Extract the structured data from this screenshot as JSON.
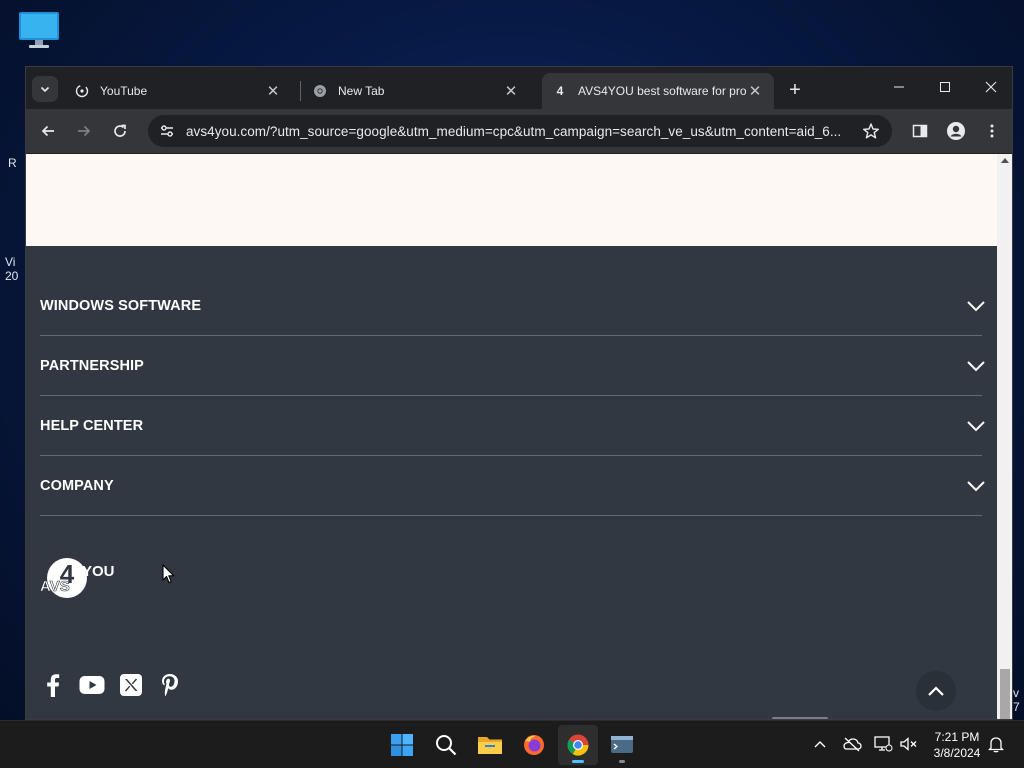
{
  "desktop": {
    "fragments": [
      "R",
      "Vi",
      "20",
      "v",
      "7"
    ]
  },
  "browser": {
    "tabs": [
      {
        "title": "YouTube",
        "close": "✕"
      },
      {
        "title": "New Tab",
        "close": "✕"
      },
      {
        "title": "AVS4YOU best software for pro",
        "favicon_text": "4",
        "close": "✕"
      }
    ],
    "new_tab_symbol": "+",
    "url": "avs4you.com/?utm_source=google&utm_medium=cpc&utm_campaign=search_ve_us&utm_content=aid_6..."
  },
  "page": {
    "footer_sections": [
      {
        "label": "WINDOWS SOFTWARE"
      },
      {
        "label": "PARTNERSHIP"
      },
      {
        "label": "HELP CENTER"
      },
      {
        "label": "COMPANY"
      }
    ],
    "logo": {
      "text_left": "AVS",
      "text_number": "4",
      "text_right": "YOU"
    },
    "social_icons": [
      "facebook-icon",
      "youtube-icon",
      "x-twitter-icon",
      "pinterest-icon"
    ]
  },
  "taskbar": {
    "apps": [
      "windows-start-icon",
      "search-icon",
      "file-explorer-icon",
      "firefox-icon",
      "chrome-icon",
      "terminal-icon"
    ],
    "time": "7:21 PM",
    "date": "3/8/2024"
  },
  "colors": {
    "footer_bg": "#313842",
    "cream_band": "#fdf8f3",
    "accent": "#4cc2ff"
  }
}
